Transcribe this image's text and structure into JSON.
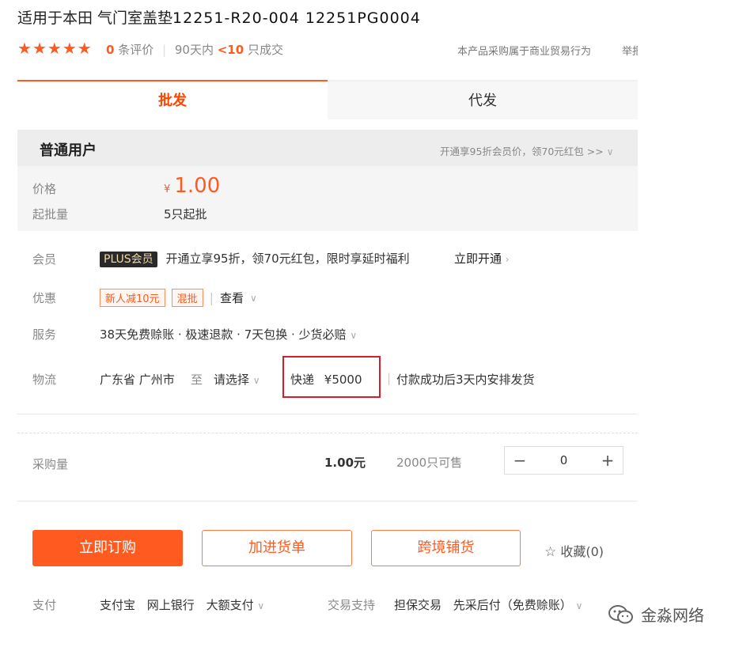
{
  "product": {
    "title": "适用于本田 气门室盖垫",
    "code_masked": "12251-R20-004 12251PG0004"
  },
  "rating": {
    "stars": 5,
    "count": "0",
    "count_suffix": "条评价",
    "period": "90天内",
    "sold": "<10",
    "sold_suffix": "只成交"
  },
  "header_notice": "本产品采购属于商业贸易行为",
  "report_label": "举报",
  "tabs": [
    {
      "label": "批发",
      "active": true
    },
    {
      "label": "代发",
      "active": false
    }
  ],
  "user_type": "普通用户",
  "member_promo": "开通享95折会员价，领70元红包 >>",
  "price": {
    "label": "价格",
    "symbol": "¥",
    "value": "1.00",
    "min_label": "起批量",
    "min_value": "5只起批"
  },
  "membership": {
    "label": "会员",
    "badge": "PLUS会员",
    "text": "开通立享95折，领70元红包，限时享延时福利",
    "link": "立即开通"
  },
  "discount": {
    "label": "优惠",
    "tags": [
      "新人减10元",
      "混批"
    ],
    "view": "查看"
  },
  "service": {
    "label": "服务",
    "text": "38天免费赊账 · 极速退款 · 7天包换 · 少货必赔"
  },
  "logistics": {
    "label": "物流",
    "from": "广东省 广州市",
    "to_label": "至",
    "select": "请选择",
    "method": "快递",
    "fee": "¥5000",
    "ship_note": "付款成功后3天内安排发货"
  },
  "purchase": {
    "label": "采购量",
    "unit_price": "1.00元",
    "stock": "2000只可售",
    "quantity": "0"
  },
  "actions": {
    "buy_now": "立即订购",
    "add_cart": "加进货单",
    "cross_border": "跨境铺货",
    "favorite": "收藏(0)"
  },
  "payment": {
    "label": "支付",
    "methods": [
      "支付宝",
      "网上银行",
      "大额支付"
    ],
    "trade_label": "交易支持",
    "trade": [
      "担保交易",
      "先采后付（免费赊账）"
    ]
  },
  "watermark": "金淼网络",
  "colors": {
    "accent": "#ff5a1f",
    "highlight_box": "#d3202a"
  }
}
